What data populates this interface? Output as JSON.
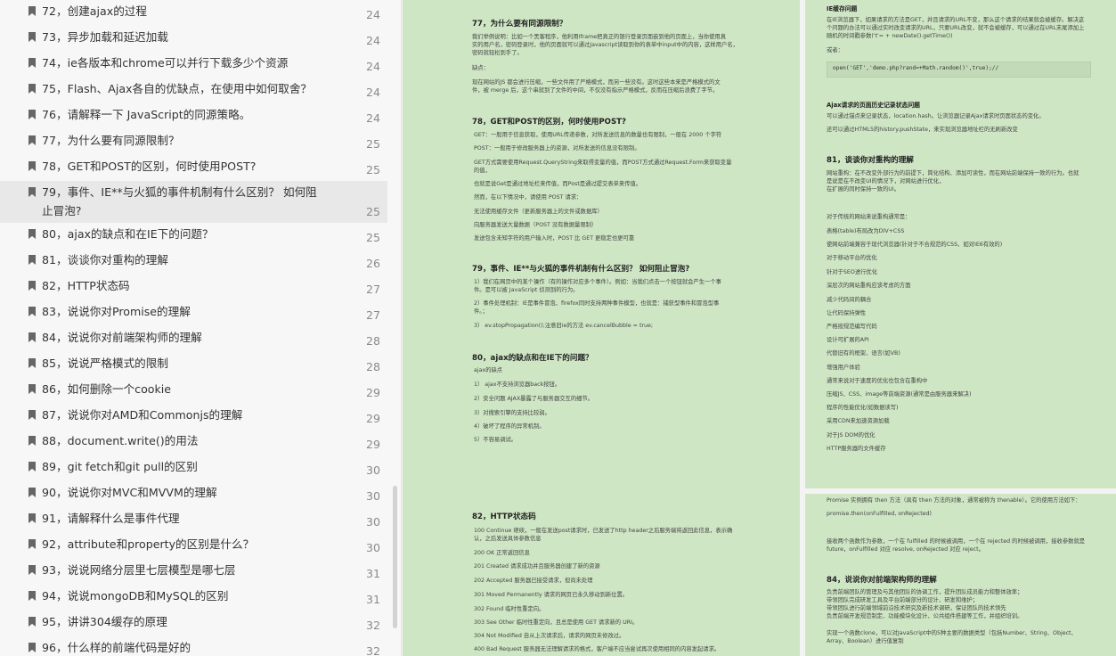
{
  "toc": [
    {
      "label": "72，创建ajax的过程",
      "page": "24"
    },
    {
      "label": "73，异步加载和延迟加载",
      "page": "24"
    },
    {
      "label": "74，ie各版本和chrome可以并行下载多少个资源",
      "page": "24"
    },
    {
      "label": "75，Flash、Ajax各自的优缺点，在使用中如何取舍？",
      "page": "24"
    },
    {
      "label": "76，请解释一下 JavaScript的同源策略。",
      "page": "24"
    },
    {
      "label": "77，为什么要有同源限制？",
      "page": "25"
    },
    {
      "label": "78，GET和POST的区别，何时使用POST?",
      "page": "25"
    },
    {
      "label": "79，事件、IE**与火狐的事件机制有什么区别？ 如何阻止冒泡?",
      "page": "25"
    },
    {
      "label": "80，ajax的缺点和在IE下的问题？",
      "page": "25"
    },
    {
      "label": "81，谈谈你对重构的理解",
      "page": "26"
    },
    {
      "label": "82，HTTP状态码",
      "page": "27"
    },
    {
      "label": "83，说说你对Promise的理解",
      "page": "27"
    },
    {
      "label": "84，说说你对前端架构师的理解",
      "page": "28"
    },
    {
      "label": "85，说说严格模式的限制",
      "page": "28"
    },
    {
      "label": "86，如何删除一个cookie",
      "page": "29"
    },
    {
      "label": "87，说说你对AMD和Commonjs的理解",
      "page": "29"
    },
    {
      "label": "88，document.write()的用法",
      "page": "29"
    },
    {
      "label": "89，git fetch和git pull的区别",
      "page": "30"
    },
    {
      "label": "90，说说你对MVC和MVVM的理解",
      "page": "30"
    },
    {
      "label": "91，请解释什么是事件代理",
      "page": "30"
    },
    {
      "label": "92，attribute和property的区别是什么？",
      "page": "30"
    },
    {
      "label": "93，说说网络分层里七层模型是哪七层",
      "page": "31"
    },
    {
      "label": "94，说说mongoDB和MySQL的区别",
      "page": "31"
    },
    {
      "label": "95，讲讲304缓存的原理",
      "page": "32"
    },
    {
      "label": "96，什么样的前端代码是好的",
      "page": "32"
    }
  ],
  "left": {
    "h77": "77，为什么要有同源限制？",
    "p77a": "我们举例说明：比如一个黑客程序，他利用Iframe把真正的银行登录页面嵌到他的页面上，当你使用真",
    "p77b": "实的用户名，密码登录时，他的页面就可以通过Javascript读取到你的表单中input中的内容，这样用户名，",
    "p77c": "密码就轻松到手了。",
    "p77d": "缺点：",
    "p77e": "现在网站的JS 都会进行压缩，一些文件用了严格模式，而另一些没有。这时这些本来是严格模式的文",
    "p77f": "件，被 merge 后，这个串就到了文件的中间，不仅没有指示严格模式，反而在压缩后浪费了字节。",
    "h78": "78，GET和POST的区别，何时使用POST?",
    "p78a": "GET：一般用于信息获取，使用URL传递参数，对所发送信息的数量也有限制，一般在 2000 个字符",
    "p78b": "POST：一般用于修改服务器上的资源，对所发送的信息没有限制。",
    "p78c": "GET方式需要使用Request.QueryString来取得变量的值，而POST方式通过Request.Form来获取变量",
    "p78d": "的值，",
    "p78e": "也就是说Get是通过地址栏来传值，而Post是通过提交表单来传值。",
    "p78f": "然而，在以下情况中，请使用 POST 请求：",
    "p78g": "无法使用缓存文件（更新服务器上的文件或数据库）",
    "p78h": "向服务器发送大量数据（POST 没有数据量限制）",
    "p78i": "发送包含未知字符的用户输入时，POST 比 GET 更稳定也更可靠",
    "h79": "79，事件、IE**与火狐的事件机制有什么区别？ 如何阻止冒泡?",
    "p79a": "1）我们在网页中的某个操作（有的操作对应多个事件）。例如：当我们点击一个按钮就会产生一个事",
    "p79b": "件。是可以被 JavaScript 侦测到的行为。",
    "p79c": "2）事件处理机制：IE是事件冒泡、firefox同时支持两种事件模型，也就是：捕获型事件和冒泡型事",
    "p79d": "件。；",
    "p79e": "3） ev.stopPropagation();注意旧ie的方法 ev.cancelBubble = true;",
    "h80": "80，ajax的缺点和在IE下的问题？",
    "p80a": "ajax的缺点",
    "p80b": "1） ajax不支持浏览器back按钮。",
    "p80c": "2）安全问题 AJAX暴露了与服务器交互的细节。",
    "p80d": "3）对搜索引擎的支持比较弱。",
    "p80e": "4）破坏了程序的异常机制。",
    "p80f": "5）不容易调试。",
    "h82": "82，HTTP状态码",
    "p82a": "100 Continue 继续，一般在发送post请求时，已发送了http header之后服务端将返回此信息，表示确",
    "p82b": "认，之后发送具体参数信息",
    "p82c": "200 OK 正常返回信息",
    "p82d": "201 Created 请求成功并且服务器创建了新的资源",
    "p82e": "202 Accepted 服务器已接受请求，但尚未处理",
    "p82f": "301 Moved Permanently 请求的网页已永久移动到新位置。",
    "p82g": "302 Found 临时性重定向。",
    "p82h": "303 See Other 临时性重定向，且总是使用 GET 请求新的 URI。",
    "p82i": "304 Not Modified 自从上次请求后，请求的网页未修改过。",
    "p82j": "400 Bad Request 服务器无法理解请求的格式，客户端不应当尝试再次使用相同的内容发起请求。"
  },
  "right1": {
    "h_ie": "IE缓存问题",
    "p1a": "在IE浏览器下，如果请求的方法是GET，并且请求的URL不变，那么这个请求的结果就会被缓存。解决这",
    "p1b": "个问题的办法可以通过实时改变请求的URL，只要URL改变，就不会被缓存，可以通过在URL末尾添加上",
    "p1c": "随机的时间戳参数('t'= + newDate().getTime())",
    "p1d": "或者：",
    "code1": "open('GET','demo.php?rand=+Math.random()',true);//",
    "h_hist": "Ajax请求的页面历史记录状态问题",
    "p1e": "可以通过锚点来记录状态，location.hash。让浏览器记录Ajax请求时页面状态的变化。",
    "p1f": "还可以通过HTML5的history.pushState，来实现浏览器地址栏的无刷新改变",
    "h81": "81，谈谈你对重构的理解",
    "p81a": "网站重构：在不改变外部行为的前提下，简化结构、添加可读性，而在网站前端保持一致的行为。也就",
    "p81b": "是说是在不改变UI的情况下，对网站进行优化，",
    "p81c": "在扩展的同时保持一致的UI。",
    "p81d": "对于传统的网站来说重构通常是：",
    "p81e": "表格(table)布局改为DIV+CSS",
    "p81f": "使网站前端兼容于现代浏览器(针对于不合规范的CSS、如对IE6有效的)",
    "p81g": "对于移动平台的优化",
    "p81h": "针对于SEO进行优化",
    "p81i": "深层次的网站重构应该考虑的方面",
    "p81j": "减少代码间的耦合",
    "p81k": "让代码保持弹性",
    "p81l": "严格按规范编写代码",
    "p81m": "设计可扩展的API",
    "p81n": "代替旧有的框架、语言(如VB)",
    "p81o": "增强用户体验",
    "p81p": "通常来说对于速度的优化也包含在重构中",
    "p81q": "压缩JS、CSS、image等前端资源(通常是由服务器来解决)",
    "p81r": "程序的性能优化(如数据读写)",
    "p81s": "采用CDN来加速资源加载",
    "p81t": "对于JS DOM的优化",
    "p81u": "HTTP服务器的文件缓存"
  },
  "right2": {
    "p2a": "Promise 实例拥有 then 方法（具有 then 方法的对象，通常被称为 thenable）。它的使用方法如下：",
    "p2b": "promise.then(onFulfilled, onRejected)",
    "p2c": "接收两个函数作为参数，一个在 fulfilled 的时候被调用，一个在 rejected 的时候被调用，接收参数就是",
    "p2d": "future，onFulfilled 对应 resolve, onRejected 对应 reject。",
    "h84": "84，说说你对前端架构师的理解",
    "p2e": "负责前端团队的管理及与其他团队的协调工作，提升团队成员能力和整体效率；",
    "p2f": "带领团队完成研发工具及平台前端部分的设计、研发和维护；",
    "p2g": "带领团队进行前端领域前沿技术研究及新技术调研，保证团队的技术领先",
    "p2h": "负责前端开发规范制定、功能模块化设计、公共组件搭建等工作，并组织培训。",
    "p2i": "实现一个函数clone，可以对JavaScript中的5种主要的数据类型（包括Number、String、Object、",
    "p2j": "Array、Boolean）进行值复制"
  }
}
